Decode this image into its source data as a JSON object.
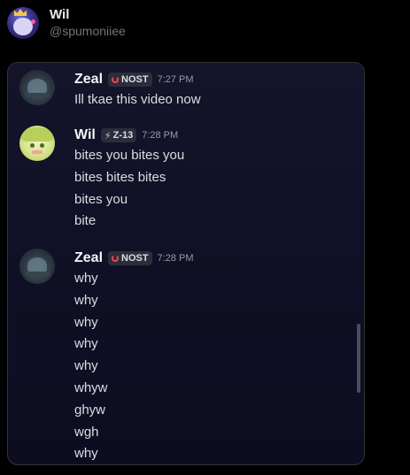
{
  "post": {
    "author_name": "Wil",
    "author_handle": "@spumoniiee"
  },
  "chat": {
    "messages": [
      {
        "username": "Zeal",
        "tag": "NOST",
        "timestamp": "7:27 PM",
        "lines": [
          "Ill tkae this video now"
        ]
      },
      {
        "username": "Wil",
        "tag": "Z-13",
        "timestamp": "7:28 PM",
        "lines": [
          "bites you bites you",
          "bites bites bites",
          "bites you",
          "bite"
        ]
      },
      {
        "username": "Zeal",
        "tag": "NOST",
        "timestamp": "7:28 PM",
        "lines": [
          "why",
          "why",
          "why",
          "why",
          "why",
          "whyw",
          "ghyw",
          "wgh",
          "why"
        ]
      }
    ]
  },
  "colors": {
    "background": "#000000",
    "card_background": "#101026",
    "nost_icon": "#f04848",
    "timestamp": "#949ba4",
    "message_text": "#dbdee1"
  },
  "icons": {
    "nost_tag_icon": "red-circle-icon",
    "z13_tag_icon": "lightning-bolt-icon"
  }
}
